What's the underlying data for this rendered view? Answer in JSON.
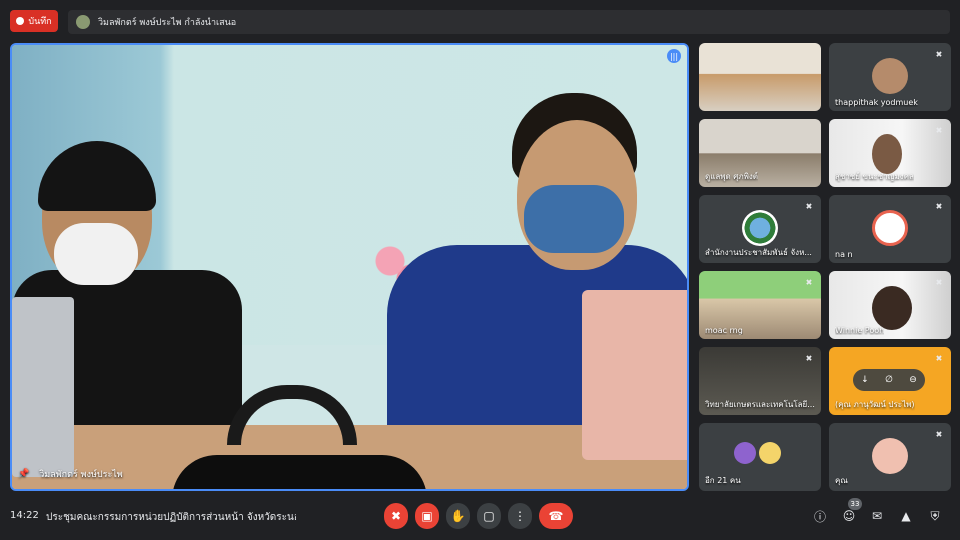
{
  "top_bar": {
    "recording_label": "บันทึก",
    "presenting_text": "วิมลพักตร์ พงษ์ประไพ กำลังนำเสนอ"
  },
  "stage": {
    "name": "วิมลพักตร์ พงษ์ประไพ"
  },
  "tiles": [
    {
      "name": ""
    },
    {
      "name": "thappithak yodmuek"
    },
    {
      "name": "ดูแลพุด ศุภพิงต์"
    },
    {
      "name": "สุชาชย์ ขนะชาญมงคล"
    },
    {
      "name": "สำนักงานประชาสัมพันธ์ จังห..."
    },
    {
      "name": "na n"
    },
    {
      "name": "moac rng"
    },
    {
      "name": "Winnie Pooh"
    },
    {
      "name": "วิทยาลัยเกษตรและเทคโนโลยี..."
    },
    {
      "name": "(คุณ ภานุวัฒน์ ประไพ)"
    },
    {
      "name": "อีก 21 คน"
    },
    {
      "name": "คุณ"
    }
  ],
  "bottom_bar": {
    "time": "14:22",
    "meeting_title": "ประชุมคณะกรรมการหน่วยปฏิบัติการส่วนหน้า จังหวัดระนอง ...",
    "participant_count": "33"
  },
  "colors": {
    "accent": "#4a8cf7",
    "danger": "#ea4335",
    "background": "#202124",
    "tile": "#3c4043"
  }
}
